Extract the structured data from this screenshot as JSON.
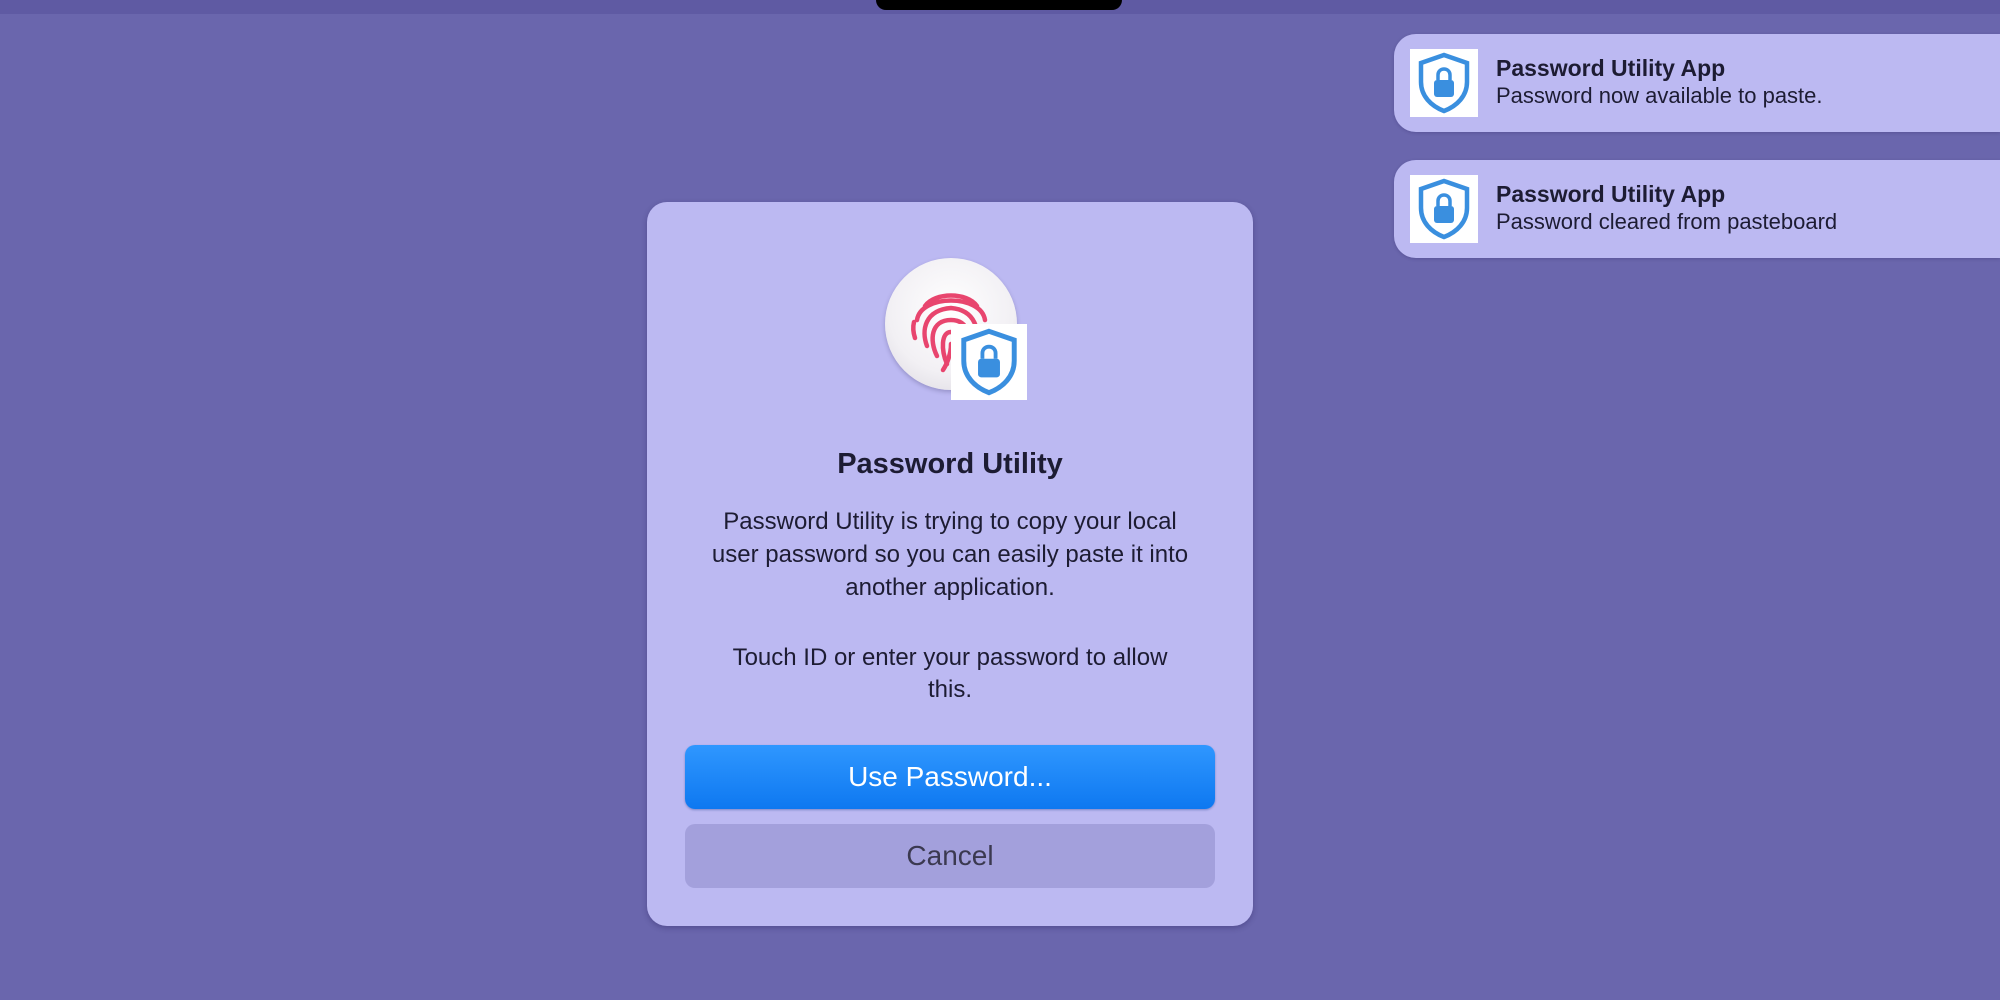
{
  "notifications": [
    {
      "title": "Password Utility App",
      "body": "Password now available to paste.",
      "icon": "shield-lock-icon"
    },
    {
      "title": "Password Utility App",
      "body": "Password cleared from pasteboard",
      "icon": "shield-lock-icon"
    }
  ],
  "dialog": {
    "title": "Password Utility",
    "message": "Password Utility is trying to copy your local user password so you can easily paste it into another application.",
    "prompt": "Touch ID or enter your password to allow this.",
    "primary_button": "Use Password...",
    "cancel_button": "Cancel",
    "icons": [
      "fingerprint-icon",
      "shield-lock-icon"
    ]
  },
  "colors": {
    "desktop": "#6a66ad",
    "panel": "#bcb9f2",
    "primary_button": "#1a86fb",
    "cancel_button": "#a3a0dc",
    "fingerprint": "#e8456e",
    "shield": "#3a8fdf"
  }
}
